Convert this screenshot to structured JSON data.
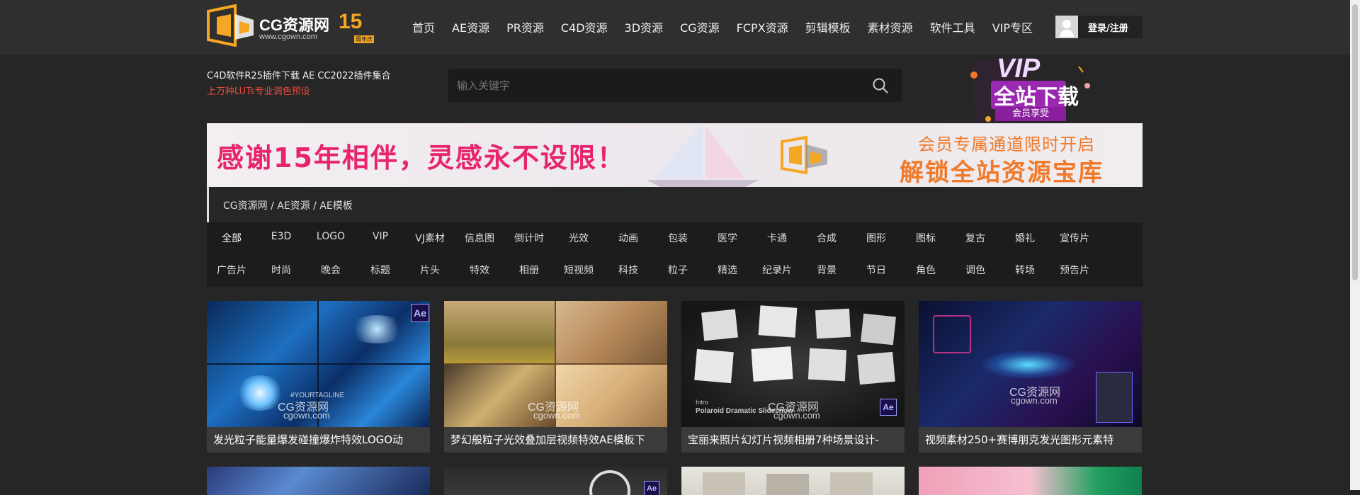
{
  "header": {
    "logo_text": "CG资源网",
    "logo_url": "www.cgown.com",
    "logo_anniv": "15",
    "logo_anniv_sub": "周年庆",
    "nav": [
      "首页",
      "AE资源",
      "PR资源",
      "C4D资源",
      "3D资源",
      "CG资源",
      "FCPX资源",
      "剪辑模板",
      "素材资源",
      "软件工具",
      "VIP专区"
    ],
    "login_label": "登录/注册"
  },
  "promo": {
    "line1": "C4D软件R25插件下载  AE CC2022插件集合",
    "line2": "上万种LUTs专业调色预设"
  },
  "search": {
    "placeholder": "输入关键字"
  },
  "vip_badge": {
    "title": "VIP",
    "subtitle": "全站下载",
    "tag": "会员享受"
  },
  "banner": {
    "left_text": "感谢15年相伴，灵感永不设限！",
    "right_line1": "会员专属通道限时开启",
    "right_line2": "解锁全站资源宝库"
  },
  "breadcrumb": "CG资源网 / AE资源 / AE模板",
  "tags_row1": [
    "全部",
    "E3D",
    "LOGO",
    "VIP",
    "VJ素材",
    "信息图",
    "倒计时",
    "光效",
    "动画",
    "包装",
    "医学",
    "卡通",
    "合成",
    "图形",
    "图标",
    "复古",
    "婚礼",
    "宣传片"
  ],
  "tags_row2": [
    "广告片",
    "时尚",
    "晚会",
    "标题",
    "片头",
    "特效",
    "相册",
    "短视频",
    "科技",
    "粒子",
    "精选",
    "纪录片",
    "背景",
    "节日",
    "角色",
    "调色",
    "转场",
    "预告片"
  ],
  "cards": [
    {
      "title": "发光粒子能量爆发碰撞爆炸特效LOGO动"
    },
    {
      "title": "梦幻般粒子光效叠加层视频特效AE模板下"
    },
    {
      "title": "宝丽来照片幻灯片视频相册7种场景设计-"
    },
    {
      "title": "视频素材250+赛博朋克发光图形元素特"
    }
  ],
  "watermark": {
    "name": "CG资源网",
    "url": "cgown.com"
  },
  "thumb_text": {
    "ae_badge": "Ae",
    "yourtagline": "#YOURTAGLINE",
    "polaroid": "Polaroid Dramatic Slideshow",
    "intro": "Intro"
  },
  "colors": {
    "accent_orange": "#f5a623",
    "promo_red": "#e84b3c",
    "banner_pink": "#e8246e",
    "banner_orange": "#f07a2a",
    "vip_purple": "#c23bd4"
  }
}
